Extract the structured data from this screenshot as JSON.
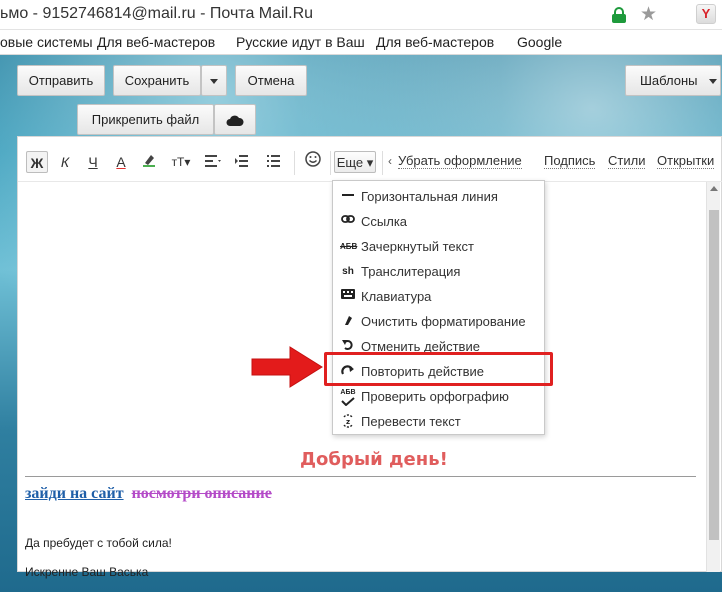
{
  "browser": {
    "title": "ьмо - 9152746814@mail.ru - Почта Mail.Ru",
    "bookmarks": [
      "овые системы",
      "Для веб-мастеров",
      "Русские идут в Ваш",
      "Для веб-мастеров",
      "Google"
    ]
  },
  "toolbar": {
    "send": "Отправить",
    "save": "Сохранить",
    "cancel": "Отмена",
    "templates": "Шаблоны",
    "attach": "Прикрепить файл"
  },
  "format": {
    "bold": "Ж",
    "italic": "К",
    "underline": "Ч",
    "font_color": "А",
    "font_size": "тТ",
    "more": "Еще",
    "remove_format": "Убрать оформление",
    "signature": "Подпись",
    "styles": "Стили",
    "cards": "Открытки"
  },
  "menu": {
    "items": [
      {
        "icon": "horizontal-line-icon",
        "label": "Горизонтальная линия"
      },
      {
        "icon": "link-icon",
        "label": "Ссылка"
      },
      {
        "icon": "strikethrough-icon",
        "label": "Зачеркнутый текст"
      },
      {
        "icon": "transliteration-icon",
        "label": "Транслитерация"
      },
      {
        "icon": "keyboard-icon",
        "label": "Клавиатура"
      },
      {
        "icon": "eraser-icon",
        "label": "Очистить форматирование"
      },
      {
        "icon": "undo-icon",
        "label": "Отменить действие"
      },
      {
        "icon": "redo-icon",
        "label": "Повторить действие"
      },
      {
        "icon": "spellcheck-icon",
        "label": "Проверить орфографию"
      },
      {
        "icon": "translate-icon",
        "label": "Перевести текст"
      }
    ],
    "highlighted_item": "Повторить действие"
  },
  "icon_glyphs": {
    "strikethrough": "АБВ",
    "transliteration": "sh",
    "spellcheck": "АБВ"
  },
  "body": {
    "greeting": "Добрый день!",
    "link1": "зайди на сайт",
    "link2": "посмотри описание",
    "line2": "Да пребудет с тобой сила!",
    "line3": "Искренне Ваш Васька"
  },
  "colors": {
    "highlight": "#e02020",
    "greeting": "#e05d5d",
    "link1": "#1f5fa8",
    "link2": "#b44bc8"
  }
}
